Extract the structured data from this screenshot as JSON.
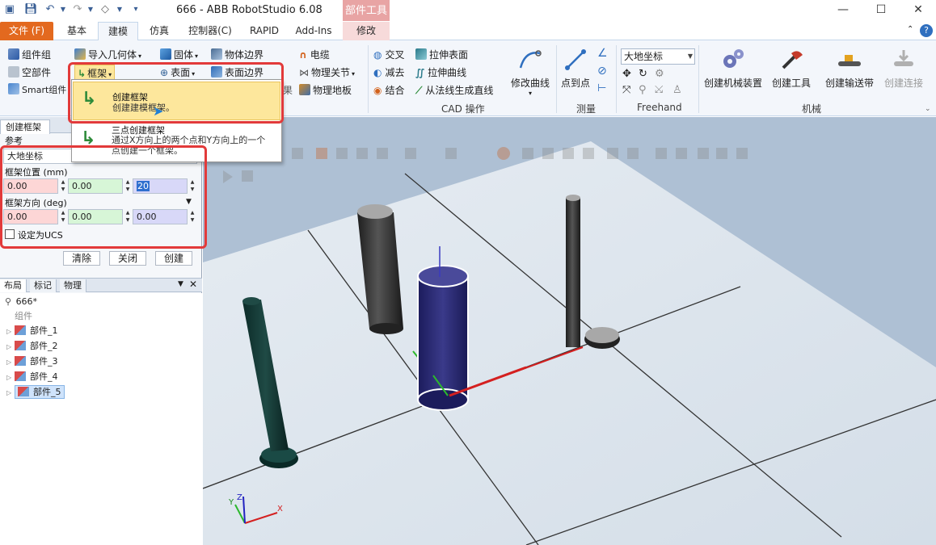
{
  "window": {
    "title": "666 - ABB RobotStudio 6.08",
    "contextual_group": "部件工具",
    "minimize": "—",
    "maximize": "☐",
    "close": "✕"
  },
  "quick_access": [
    "save-icon",
    "undo-icon",
    "undo-dropdown-icon",
    "redo-icon",
    "redo-dropdown-icon",
    "tag-icon",
    "customize-icon"
  ],
  "tabs": {
    "file": "文件 (F)",
    "basic": "基本",
    "modeling": "建模",
    "simulation": "仿真",
    "controller": "控制器(C)",
    "rapid": "RAPID",
    "addins": "Add-Ins",
    "modify": "修改",
    "help": "?"
  },
  "ribbon": {
    "component_group": "组件组",
    "empty_part": "空部件",
    "smart_component": "Smart组件",
    "import_geometry": "导入几何体",
    "frame": "框架",
    "solid": "固体",
    "surface": "表面",
    "body_boundary": "物体边界",
    "surface_boundary": "表面边界",
    "cable": "电缆",
    "physics_joint": "物理关节",
    "physics_floor": "物理地板",
    "intersect": "交叉",
    "subtract": "减去",
    "union": "结合",
    "extrude_surface": "拉伸表面",
    "extrude_curve": "拉伸曲线",
    "line_from_normal": "从法线生成直线",
    "modify_curve": "修改曲线",
    "cad_group": "CAD 操作",
    "point_to_point": "点到点",
    "measure_group": "测量",
    "world_coord": "大地坐标",
    "freehand_group": "Freehand",
    "create_mechanism": "创建机械装置",
    "create_tool": "创建工具",
    "create_conveyor": "创建输送带",
    "create_connection": "创建连接",
    "mechanism_group": "机械"
  },
  "dropdown": {
    "item1_title": "创建框架",
    "item1_desc": "创建建模框架。",
    "item2_title": "三点创建框架",
    "item2_desc": "通过X方向上的两个点和Y方向上的一个点创建一个框架。"
  },
  "panel": {
    "tab": "创建框架",
    "reference_label": "参考",
    "reference_value": "大地坐标",
    "position_label": "框架位置 (mm)",
    "position": [
      "0.00",
      "0.00",
      "20"
    ],
    "orientation_label": "框架方向 (deg)",
    "orientation": [
      "0.00",
      "0.00",
      "0.00"
    ],
    "set_ucs": "设定为UCS",
    "clear": "清除",
    "close": "关闭",
    "create": "创建"
  },
  "layout": {
    "tabs": [
      "布局",
      "标记",
      "物理"
    ],
    "station": "666*",
    "components": "组件",
    "parts": [
      "部件_1",
      "部件_2",
      "部件_3",
      "部件_4",
      "部件_5"
    ]
  },
  "axes": {
    "x": "X",
    "y": "Y",
    "z": "Z"
  },
  "colors": {
    "file_tab": "#e3691f",
    "highlight": "#e23a3a",
    "viewport_bg": "#aec0d4",
    "selected_part": "#2a2a70"
  }
}
